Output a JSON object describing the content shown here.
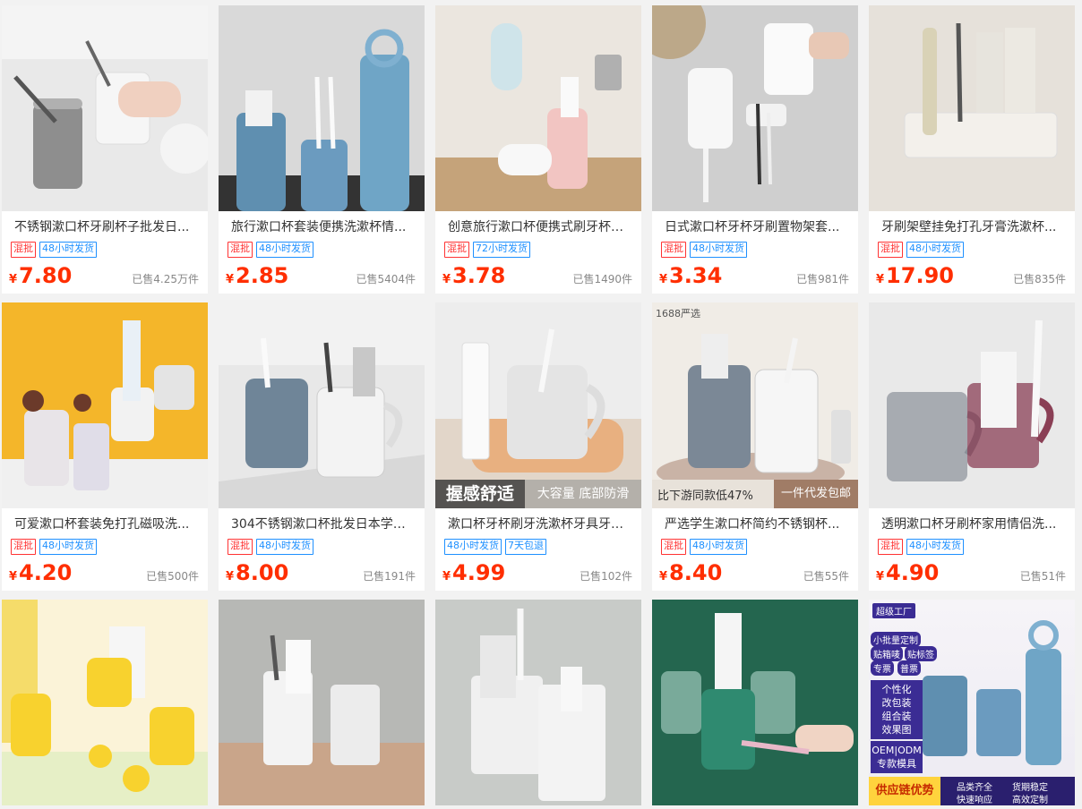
{
  "products": [
    {
      "title": "不锈钢漱口杯牙刷杯子批发日...",
      "tags": [
        {
          "text": "混批",
          "color": "red"
        },
        {
          "text": "48小时发货",
          "color": "blue"
        }
      ],
      "price": "7.80",
      "sold": "已售4.25万件"
    },
    {
      "title": "旅行漱口杯套装便携洗漱杯情...",
      "tags": [
        {
          "text": "混批",
          "color": "red"
        },
        {
          "text": "48小时发货",
          "color": "blue"
        }
      ],
      "price": "2.85",
      "sold": "已售5404件"
    },
    {
      "title": "创意旅行漱口杯便携式刷牙杯三...",
      "tags": [
        {
          "text": "混批",
          "color": "red"
        },
        {
          "text": "72小时发货",
          "color": "blue"
        }
      ],
      "price": "3.78",
      "sold": "已售1490件"
    },
    {
      "title": "日式漱口杯牙杯牙刷置物架套...",
      "tags": [
        {
          "text": "混批",
          "color": "red"
        },
        {
          "text": "48小时发货",
          "color": "blue"
        }
      ],
      "price": "3.34",
      "sold": "已售981件"
    },
    {
      "title": "牙刷架壁挂免打孔牙膏洗漱杯...",
      "tags": [
        {
          "text": "混批",
          "color": "red"
        },
        {
          "text": "48小时发货",
          "color": "blue"
        }
      ],
      "price": "17.90",
      "sold": "已售835件"
    },
    {
      "title": "可爱漱口杯套装免打孔磁吸洗...",
      "tags": [
        {
          "text": "混批",
          "color": "red"
        },
        {
          "text": "48小时发货",
          "color": "blue"
        }
      ],
      "price": "4.20",
      "sold": "已售500件"
    },
    {
      "title": "304不锈钢漱口杯批发日本学生...",
      "tags": [
        {
          "text": "混批",
          "color": "red"
        },
        {
          "text": "48小时发货",
          "color": "blue"
        }
      ],
      "price": "8.00",
      "sold": "已售191件"
    },
    {
      "title": "漱口杯牙杯刷牙洗漱杯牙具牙刷...",
      "tags": [
        {
          "text": "48小时发货",
          "color": "blue"
        },
        {
          "text": "7天包退",
          "color": "blue"
        }
      ],
      "price": "4.99",
      "sold": "已售102件",
      "overlay_left": "握感舒适",
      "overlay_right": "大容量 底部防滑"
    },
    {
      "title": "严选学生漱口杯简约不锈钢杯...",
      "tags": [
        {
          "text": "混批",
          "color": "red"
        },
        {
          "text": "48小时发货",
          "color": "blue"
        }
      ],
      "price": "8.40",
      "sold": "已售55件",
      "badge": "1688严选",
      "banner_left": "比下游同款低47%",
      "banner_right": "一件代发包邮"
    },
    {
      "title": "透明漱口杯牙刷杯家用情侣洗...",
      "tags": [
        {
          "text": "混批",
          "color": "red"
        },
        {
          "text": "48小时发货",
          "color": "blue"
        }
      ],
      "price": "4.90",
      "sold": "已售51件"
    }
  ],
  "row3": {
    "factory": {
      "logo": "超级工厂",
      "chips": [
        "小批量定制",
        "贴箱唛",
        "贴标签",
        "专票",
        "普票"
      ],
      "box1": [
        "个性化",
        "改包装",
        "组合装",
        "效果图"
      ],
      "box2": [
        "OEM",
        "ODM",
        "专款模具"
      ],
      "bottom_main": "供应链优势",
      "bottom_items": [
        "品类齐全",
        "货期稳定",
        "快速响应",
        "高效定制"
      ]
    }
  },
  "currency": "¥",
  "colors": {
    "price": "#ff2e00",
    "tag_blue": "#1e90ff",
    "tag_red": "#ff3333"
  }
}
